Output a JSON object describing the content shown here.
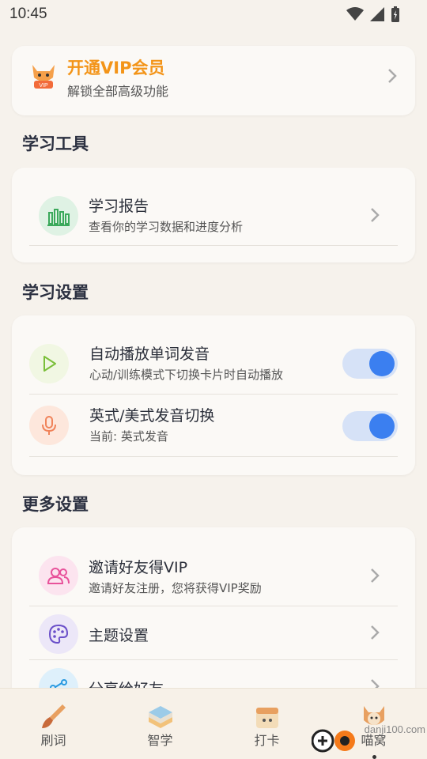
{
  "status": {
    "time": "10:45"
  },
  "vip": {
    "title": "开通VIP会员",
    "subtitle": "解锁全部高级功能",
    "badge_text": "VIP"
  },
  "sections": {
    "tools": "学习工具",
    "settings": "学习设置",
    "more": "更多设置"
  },
  "tools": {
    "report_title": "学习报告",
    "report_sub": "查看你的学习数据和进度分析"
  },
  "settings": {
    "autoplay_title": "自动播放单词发音",
    "autoplay_sub": "心动/训练模式下切换卡片时自动播放",
    "autoplay_on": true,
    "accent_title": "英式/美式发音切换",
    "accent_sub": "当前: 英式发音",
    "accent_on": true
  },
  "more": {
    "invite_title": "邀请好友得VIP",
    "invite_sub": "邀请好友注册，您将获得VIP奖励",
    "theme_title": "主题设置",
    "share_title": "分享给好友"
  },
  "nav": [
    {
      "label": "刷词"
    },
    {
      "label": "智学"
    },
    {
      "label": "打卡"
    },
    {
      "label": "喵窝"
    }
  ],
  "watermark": "danji100.com",
  "colors": {
    "accent": "#3b7ff0",
    "vip_orange": "#f39418",
    "background": "#f6f2ec"
  }
}
